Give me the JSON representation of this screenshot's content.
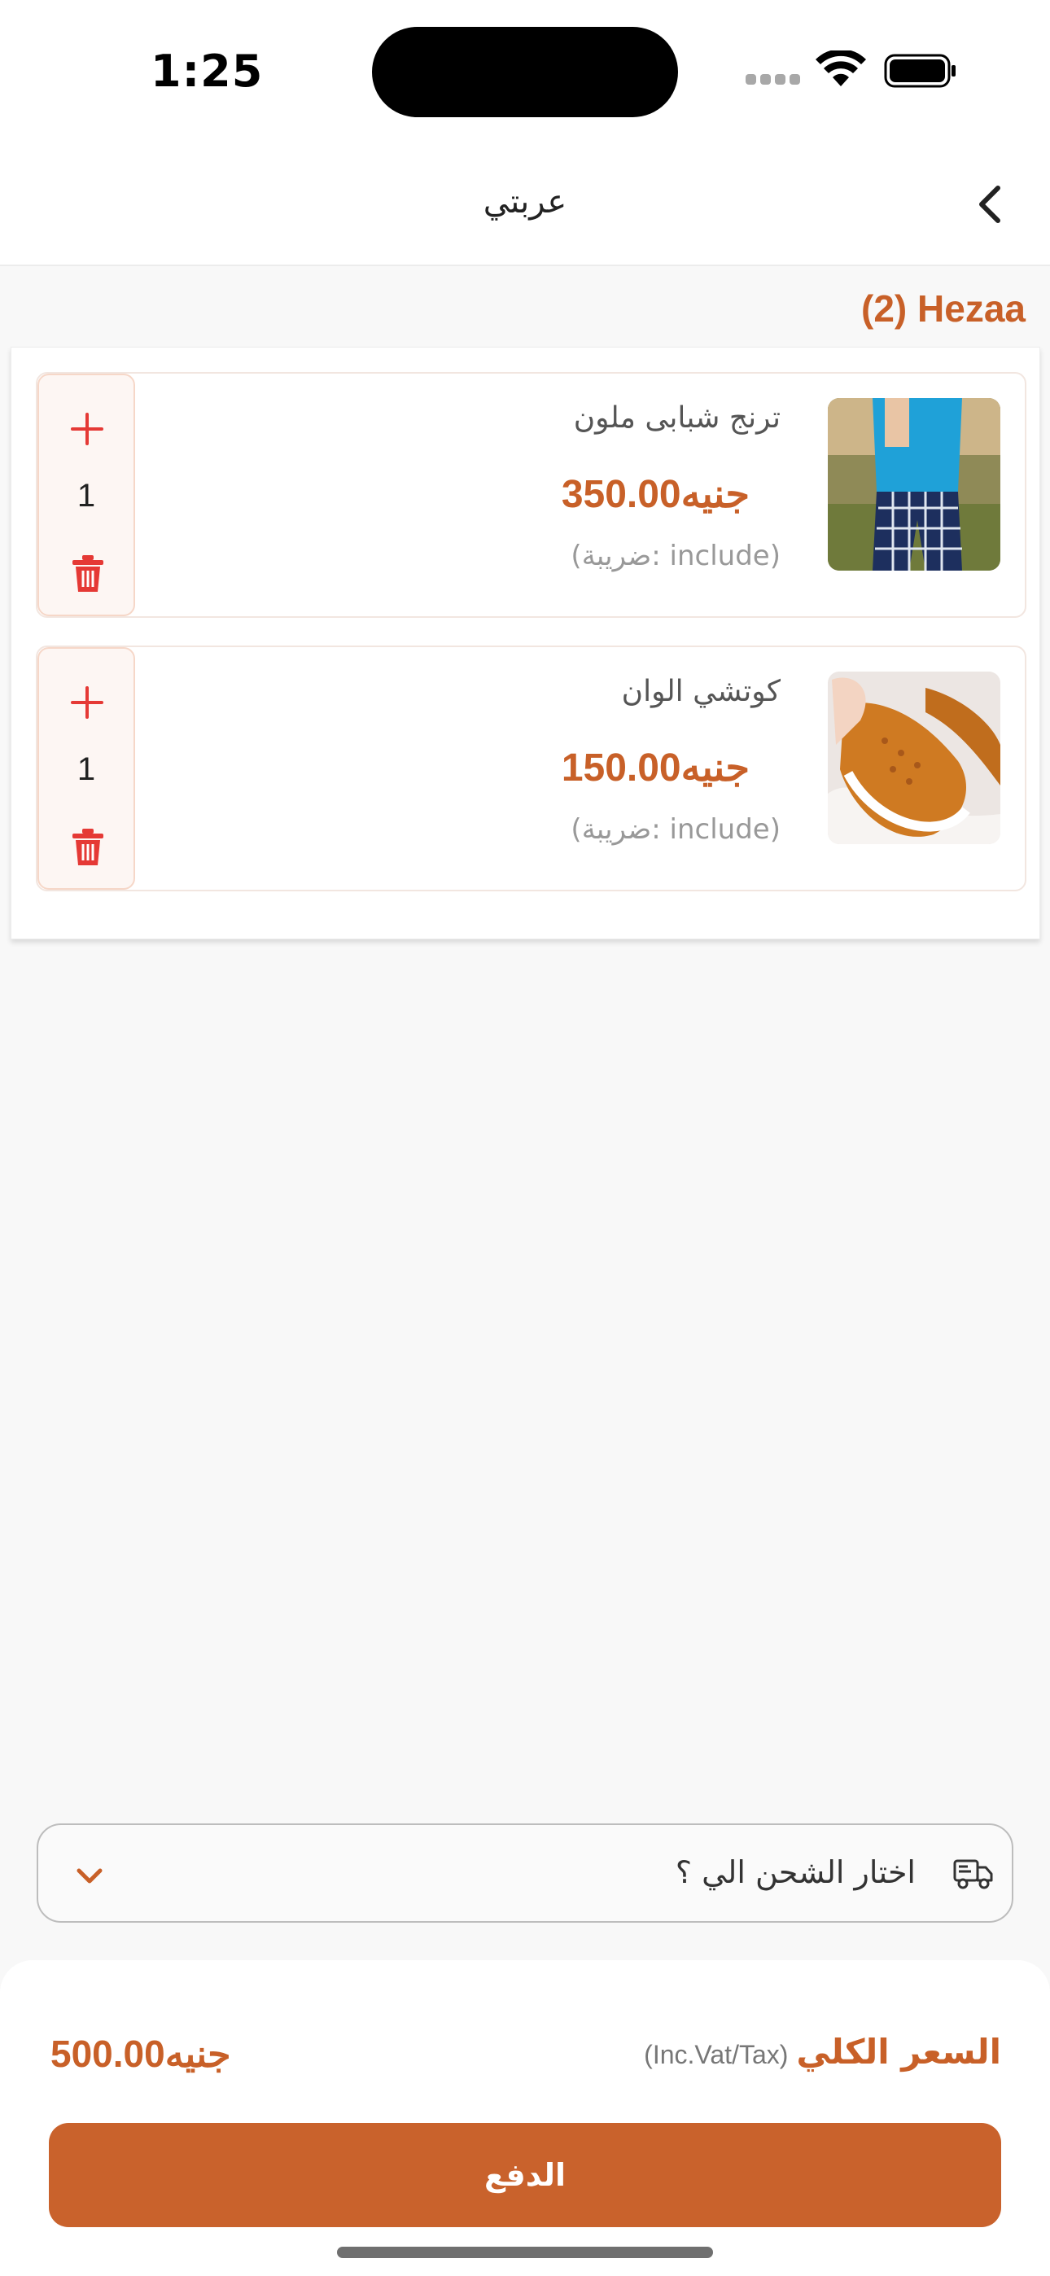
{
  "status_bar": {
    "time": "1:25"
  },
  "nav": {
    "title": "عربتي",
    "back_icon": "chevron-left-icon"
  },
  "store": {
    "name": "(2) Hezaa"
  },
  "cart": {
    "items": [
      {
        "name": "ترنج شبابى ملون",
        "price": "جنيه350.00",
        "tax": "(ضريبة: include)",
        "quantity": "1",
        "image": "blue-shirt-plaid-pants-photo"
      },
      {
        "name": "كوتشي الوان",
        "price": "جنيه150.00",
        "tax": "(ضريبة: include)",
        "quantity": "1",
        "image": "orange-knit-sneaker-photo"
      }
    ]
  },
  "shipping": {
    "placeholder": "اختار الشحن الي ؟",
    "icon": "truck-icon"
  },
  "summary": {
    "total_label": "السعر الكلي",
    "total_note": "(Inc.Vat/Tax)",
    "total_value": "جنيه500.00",
    "pay_label": "الدفع"
  },
  "colors": {
    "accent": "#c86028",
    "button": "#c9622c",
    "danger": "#e53935"
  }
}
